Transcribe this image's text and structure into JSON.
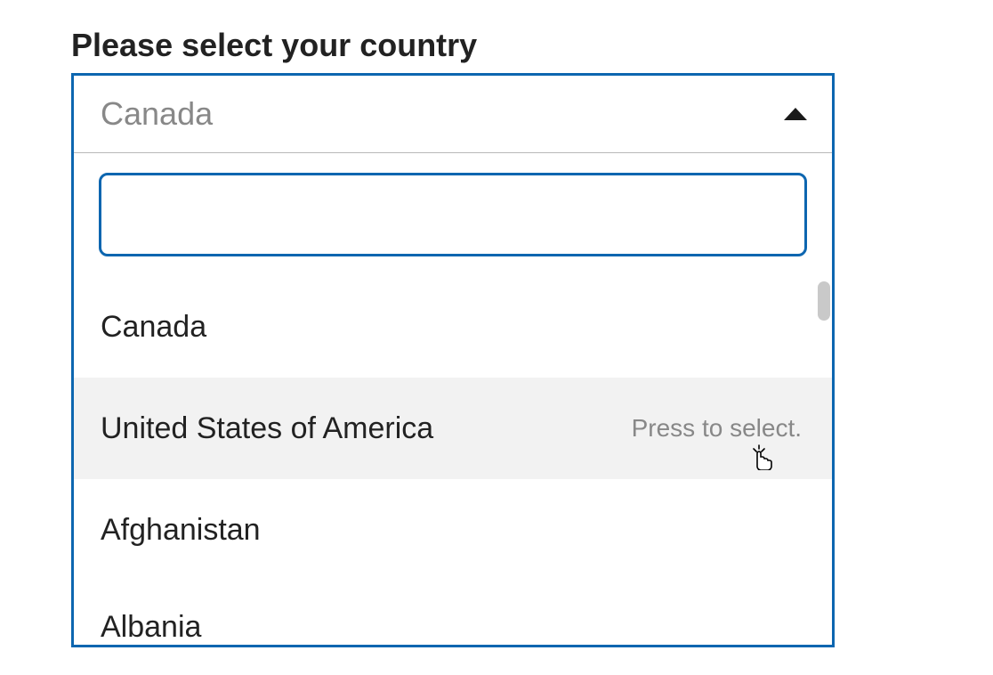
{
  "label": "Please select your country",
  "selected": "Canada",
  "search_value": "",
  "hint_text": "Press to select.",
  "options": [
    "Canada",
    "United States of America",
    "Afghanistan",
    "Albania"
  ]
}
